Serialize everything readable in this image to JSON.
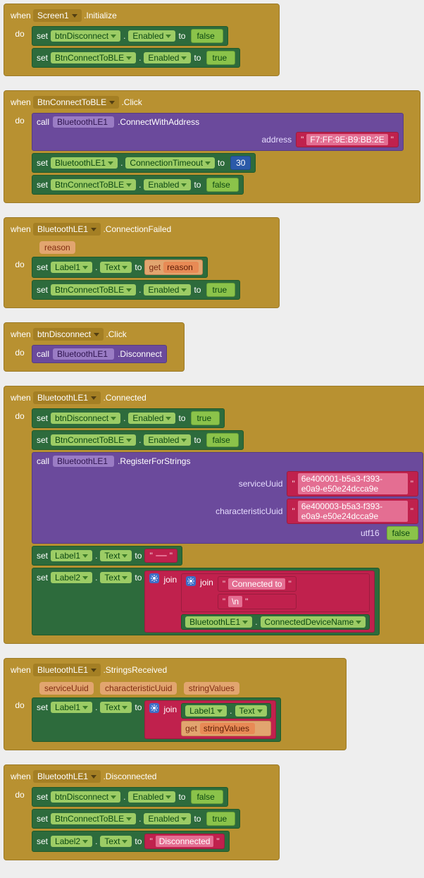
{
  "kw": {
    "when": "when",
    "do": "do",
    "set": "set",
    "to": "to",
    "call": "call",
    "get": "get",
    "join": "join"
  },
  "props": {
    "enabled": "Enabled",
    "text": "Text",
    "ct": "ConnectionTimeout",
    "connectedDeviceName": "ConnectedDeviceName"
  },
  "comp": {
    "screen1": "Screen1",
    "btnDisconnect": "btnDisconnect",
    "btnConnectToBLE": "BtnConnectToBLE",
    "ble1": "BluetoothLE1",
    "label1": "Label1",
    "label2": "Label2"
  },
  "events": {
    "initialize": ".Initialize",
    "click": ".Click",
    "connFailed": ".ConnectionFailed",
    "connected": ".Connected",
    "stringsReceived": ".StringsReceived",
    "disconnected": ".Disconnected"
  },
  "methods": {
    "connectWithAddress": ".ConnectWithAddress",
    "disconnect": ".Disconnect",
    "registerForStrings": ".RegisterForStrings"
  },
  "args": {
    "address": "address",
    "serviceUuid": "serviceUuid",
    "characteristicUuid": "characteristicUuid",
    "utf16": "utf16"
  },
  "params": {
    "reason": "reason",
    "serviceUuid": "serviceUuid",
    "characteristicUuid": "characteristicUuid",
    "stringValues": "stringValues"
  },
  "bool": {
    "true": "true",
    "false": "false"
  },
  "vals": {
    "mac": "F7:FF:9E:B9:BB:2E",
    "timeout": "30",
    "svcUuid": "6e400001-b5a3-f393-e0a9-e50e24dcca9e",
    "charUuid": "6e400003-b5a3-f393-e0a9-e50e24dcca9e",
    "empty": "",
    "connectedTo": "Connected to",
    "newline": "\\n",
    "disconnected": "Disconnected"
  }
}
